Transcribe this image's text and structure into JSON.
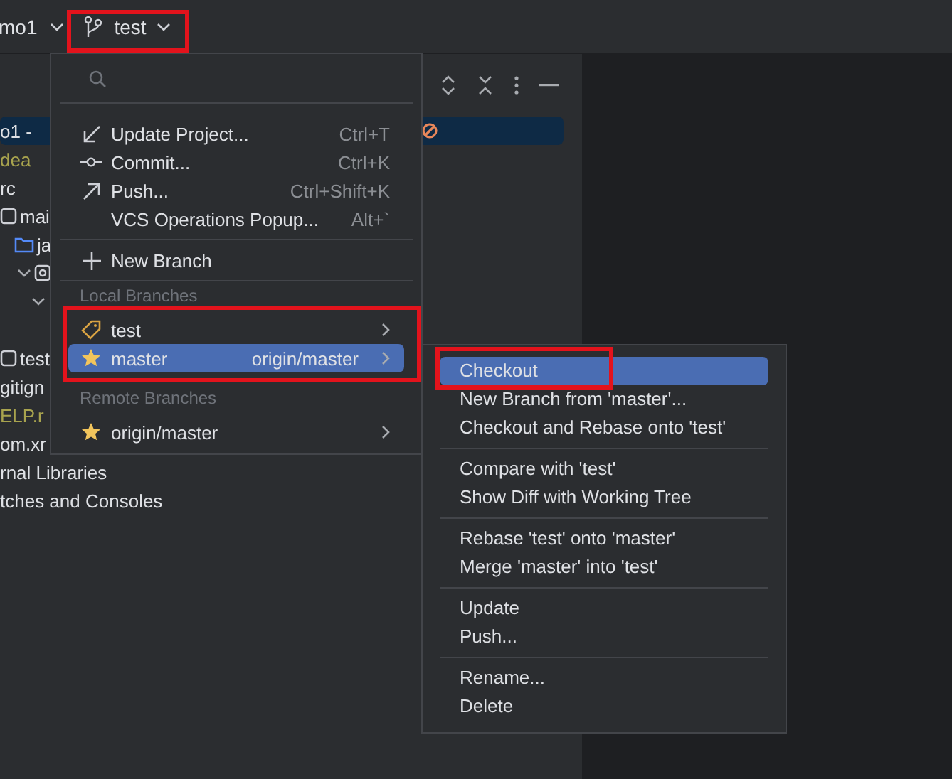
{
  "toolbar": {
    "project": "mo1",
    "branch": "test"
  },
  "project_panel": {
    "tree": [
      {
        "label": "o1 -",
        "selected": true,
        "kind": "none"
      },
      {
        "label": "dea",
        "selected": false,
        "kind": "none",
        "color": "#a8a34e"
      },
      {
        "label": "rc",
        "selected": false,
        "kind": "none"
      },
      {
        "label": "mai",
        "selected": false,
        "kind": "module",
        "children": [
          {
            "label": "ja",
            "selected": false,
            "kind": "folder"
          },
          {
            "selected": false,
            "kind": "package",
            "expanded": true,
            "children": [
              {
                "selected": false,
                "expanded": true
              }
            ]
          }
        ]
      },
      {
        "label": "test",
        "selected": false,
        "kind": "module"
      },
      {
        "label": "gitign",
        "selected": false,
        "kind": "none"
      },
      {
        "label": "ELP.r",
        "selected": false,
        "kind": "none",
        "color": "#a8a34e"
      },
      {
        "label": "om.xr",
        "selected": false,
        "kind": "none"
      },
      {
        "label": "rnal Libraries",
        "selected": false,
        "kind": "none"
      },
      {
        "label": "tches and Consoles",
        "selected": false,
        "kind": "none"
      }
    ]
  },
  "branch_popup": {
    "actions": [
      {
        "label": "Update Project...",
        "shortcut": "Ctrl+T",
        "kind": "update"
      },
      {
        "label": "Commit...",
        "shortcut": "Ctrl+K",
        "kind": "commit"
      },
      {
        "label": "Push...",
        "shortcut": "Ctrl+Shift+K",
        "kind": "push"
      },
      {
        "label": "VCS Operations Popup...",
        "shortcut": "Alt+`",
        "kind": "none"
      }
    ],
    "new_branch": "New Branch",
    "sections": [
      {
        "title": "Local Branches",
        "branches": [
          {
            "label": "test",
            "kind": "tag",
            "selected": false
          },
          {
            "label": "master",
            "kind": "favorite",
            "tracking": "origin/master",
            "selected": true
          }
        ]
      },
      {
        "title": "Remote Branches",
        "branches": [
          {
            "label": "origin/master",
            "kind": "favorite",
            "selected": false
          }
        ]
      }
    ]
  },
  "submenu": {
    "groups": [
      {
        "items": [
          {
            "label": "Checkout",
            "selected": true
          },
          {
            "label": "New Branch from 'master'...",
            "selected": false
          },
          {
            "label": "Checkout and Rebase onto 'test'",
            "selected": false
          }
        ]
      },
      {
        "items": [
          {
            "label": "Compare with 'test'",
            "selected": false
          },
          {
            "label": "Show Diff with Working Tree",
            "selected": false
          }
        ]
      },
      {
        "items": [
          {
            "label": "Rebase 'test' onto 'master'",
            "selected": false
          },
          {
            "label": "Merge 'master' into 'test'",
            "selected": false
          }
        ]
      },
      {
        "items": [
          {
            "label": "Update",
            "selected": false
          },
          {
            "label": "Push...",
            "selected": false
          }
        ]
      },
      {
        "items": [
          {
            "label": "Rename...",
            "selected": false
          },
          {
            "label": "Delete",
            "selected": false
          }
        ]
      }
    ]
  }
}
